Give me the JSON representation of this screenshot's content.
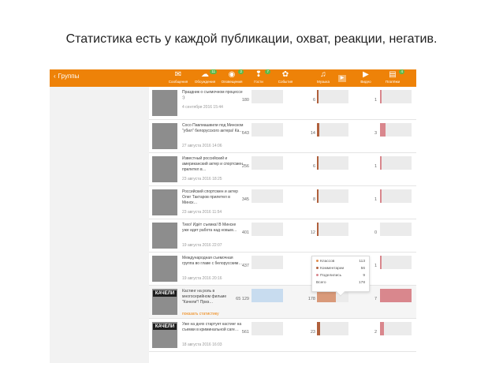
{
  "caption": "Статистика есть у каждой публикации, охват, реакции, негатив.",
  "header": {
    "back_label": "Группы",
    "nav": [
      {
        "label": "Сообщения",
        "icon": "envelope-icon",
        "glyph": "✉",
        "count": ""
      },
      {
        "label": "Обсуждения",
        "icon": "chat-icon",
        "glyph": "☁",
        "count": "11"
      },
      {
        "label": "Оповещения",
        "icon": "bell-icon",
        "glyph": "◉",
        "count": "2"
      },
      {
        "label": "Гости",
        "icon": "footprints-icon",
        "glyph": "❢",
        "count": "7"
      },
      {
        "label": "События",
        "icon": "events-icon",
        "glyph": "✿",
        "count": ""
      },
      {
        "label": "Музыка",
        "icon": "music-icon",
        "glyph": "♫",
        "count": ""
      },
      {
        "label": "Видео",
        "icon": "video-icon",
        "glyph": "▶",
        "count": ""
      },
      {
        "label": "Платёжи",
        "icon": "payment-icon",
        "glyph": "▤",
        "count": "4"
      }
    ]
  },
  "colors": {
    "topbar": "#ee8208",
    "reactions": "#d99a7a",
    "reactions_dark": "#b0603c",
    "negative": "#d9878d",
    "reach_highlight": "#c8dcef"
  },
  "posts": [
    {
      "title": "Праздник о съемочном процессе :)",
      "date": "4 сентября 2016 15:44",
      "reach": "180",
      "reactions": "6",
      "reactions_fill": 0.05,
      "negative": "1",
      "negative_fill": 0.05,
      "highlight": false,
      "link": ""
    },
    {
      "title": "Сосо Павлиашвили под Минском \"убил\" белорусского актера! Ка…",
      "date": "27 августа 2016 14:06",
      "reach": "643",
      "reactions": "14",
      "reactions_fill": 0.08,
      "negative": "3",
      "negative_fill": 0.18,
      "highlight": false,
      "link": ""
    },
    {
      "title": "Известный российский и американский актер и спортсмен прилетел в…",
      "date": "23 августа 2016 18:25",
      "reach": "256",
      "reactions": "6",
      "reactions_fill": 0.05,
      "negative": "1",
      "negative_fill": 0.05,
      "highlight": false,
      "link": ""
    },
    {
      "title": "Российский спортсмен и актер Олег Тактаров прилетел в Минск…",
      "date": "23 августа 2016 11:54",
      "reach": "345",
      "reactions": "8",
      "reactions_fill": 0.05,
      "negative": "1",
      "negative_fill": 0.05,
      "highlight": false,
      "link": ""
    },
    {
      "title": "Тихо! Идёт съемка! В Минске уже идет работа над новым…",
      "date": "19 августа 2016 22:07",
      "reach": "401",
      "reactions": "12",
      "reactions_fill": 0.05,
      "negative": "0",
      "negative_fill": 0,
      "highlight": false,
      "link": ""
    },
    {
      "title": "Международная съемочная группа во главе с белорусским…",
      "date": "19 августа 2016 20:16",
      "reach": "437",
      "reactions": "",
      "reactions_fill": 0,
      "negative": "1",
      "negative_fill": 0.05,
      "highlight": false,
      "link": ""
    },
    {
      "title": "Кастинг на роль в многосерийном фильме \"Качели\"! Приз…",
      "date": "",
      "reach": "65 129",
      "reactions": "178",
      "reactions_fill": 0.6,
      "negative": "7",
      "negative_fill": 1,
      "highlight": true,
      "link": "показать статистику"
    },
    {
      "title": "Уже на днях стартует кастинг на съемки в криминальной саге…",
      "date": "18 августа 2016 16:03",
      "reach": "561",
      "reactions": "23",
      "reactions_fill": 0.1,
      "negative": "2",
      "negative_fill": 0.12,
      "highlight": false,
      "link": ""
    }
  ],
  "tooltip": {
    "items": [
      {
        "label": "Классов",
        "value": "113",
        "color": "#e08c4c"
      },
      {
        "label": "Комментарии",
        "value": "56",
        "color": "#b0603c"
      },
      {
        "label": "Поделились",
        "value": "9",
        "color": "#d9878d"
      },
      {
        "label": "Всего",
        "value": "178",
        "color": ""
      }
    ]
  }
}
